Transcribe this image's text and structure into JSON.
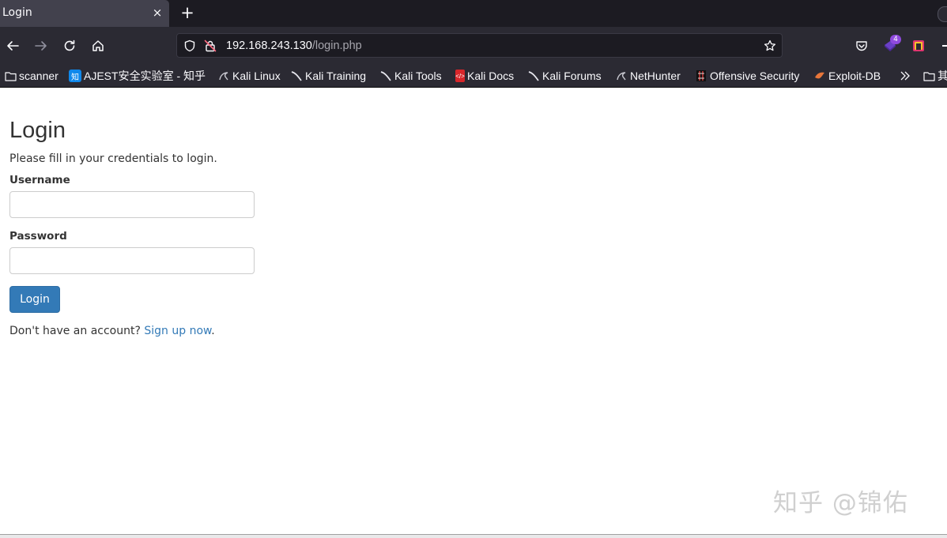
{
  "browser": {
    "tab": {
      "title": "Login",
      "close_glyph": "×"
    },
    "new_tab_glyph": "+",
    "url": {
      "host": "192.168.243.130",
      "path": "/login.php"
    },
    "extensions": {
      "badge_count": "4"
    }
  },
  "bookmarks": [
    {
      "label": "scanner",
      "icon": "folder-icon"
    },
    {
      "label": "AJEST安全实验室 - 知乎",
      "icon": "zhihu-icon"
    },
    {
      "label": "Kali Linux",
      "icon": "kali-icon"
    },
    {
      "label": "Kali Training",
      "icon": "kali-icon"
    },
    {
      "label": "Kali Tools",
      "icon": "kali-icon"
    },
    {
      "label": "Kali Docs",
      "icon": "kali-docs-icon"
    },
    {
      "label": "Kali Forums",
      "icon": "kali-icon"
    },
    {
      "label": "NetHunter",
      "icon": "kali-icon"
    },
    {
      "label": "Offensive Security",
      "icon": "offsec-icon"
    },
    {
      "label": "Exploit-DB",
      "icon": "exploitdb-icon"
    },
    {
      "label": "其",
      "icon": "folder-icon"
    }
  ],
  "page": {
    "title": "Login",
    "subtitle": "Please fill in your credentials to login.",
    "username_label": "Username",
    "username_value": "",
    "password_label": "Password",
    "password_value": "",
    "submit_label": "Login",
    "signup_prompt": "Don't have an account?",
    "signup_link": "Sign up now",
    "signup_end": "."
  },
  "watermark": "知乎 @锦佑",
  "colors": {
    "primary": "#337ab7",
    "text": "#333333",
    "chrome_dark": "#1c1b22",
    "chrome": "#2b2a33"
  }
}
